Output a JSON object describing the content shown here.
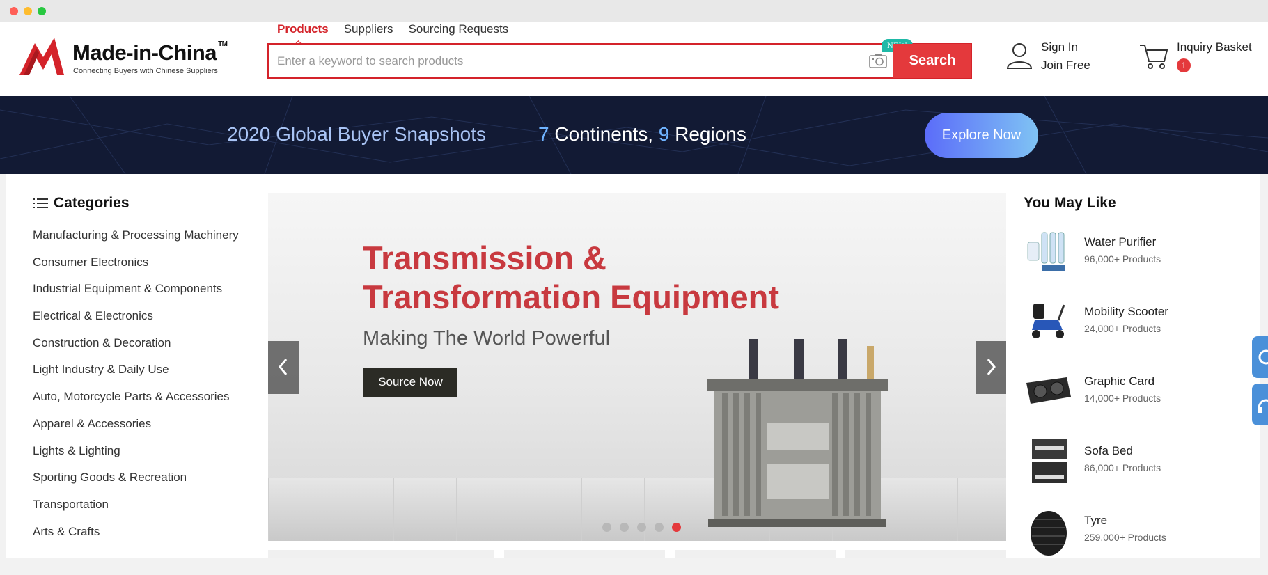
{
  "header": {
    "logo_name": "Made-in-China",
    "logo_tm": "TM",
    "logo_tagline": "Connecting Buyers with Chinese Suppliers",
    "search_tabs": [
      "Products",
      "Suppliers",
      "Sourcing Requests"
    ],
    "search_placeholder": "Enter a keyword to search products",
    "new_badge": "NEW",
    "search_button": "Search",
    "sign_in": "Sign In",
    "join_free": "Join Free",
    "basket_label": "Inquiry Basket",
    "basket_count": "1"
  },
  "promo_banner": {
    "title": "2020 Global Buyer Snapshots",
    "continents_num": "7",
    "continents_text": "Continents,",
    "regions_num": "9",
    "regions_text": "Regions",
    "button": "Explore Now"
  },
  "categories": {
    "heading": "Categories",
    "items": [
      "Manufacturing & Processing Machinery",
      "Consumer Electronics",
      "Industrial Equipment & Components",
      "Electrical & Electronics",
      "Construction & Decoration",
      "Light Industry & Daily Use",
      "Auto, Motorcycle Parts & Accessories",
      "Apparel & Accessories",
      "Lights & Lighting",
      "Sporting Goods & Recreation",
      "Transportation",
      "Arts & Crafts"
    ]
  },
  "carousel": {
    "title_line1": "Transmission &",
    "title_line2": "Transformation Equipment",
    "subtitle": "Making The World Powerful",
    "button": "Source Now",
    "slide_count": 5,
    "active_slide": 5
  },
  "you_may_like": {
    "heading": "You May Like",
    "items": [
      {
        "name": "Water Purifier",
        "count": "96,000+ Products",
        "icon": "water-purifier-icon"
      },
      {
        "name": "Mobility Scooter",
        "count": "24,000+ Products",
        "icon": "mobility-scooter-icon"
      },
      {
        "name": "Graphic Card",
        "count": "14,000+ Products",
        "icon": "graphic-card-icon"
      },
      {
        "name": "Sofa Bed",
        "count": "86,000+ Products",
        "icon": "sofa-bed-icon"
      },
      {
        "name": "Tyre",
        "count": "259,000+ Products",
        "icon": "tyre-icon"
      }
    ]
  },
  "colors": {
    "brand_red": "#d4232a",
    "search_button": "#e4393c",
    "banner_bg": "#121a34",
    "new_badge": "#1fb9a7",
    "floating_buttons": "#4a90d9"
  }
}
